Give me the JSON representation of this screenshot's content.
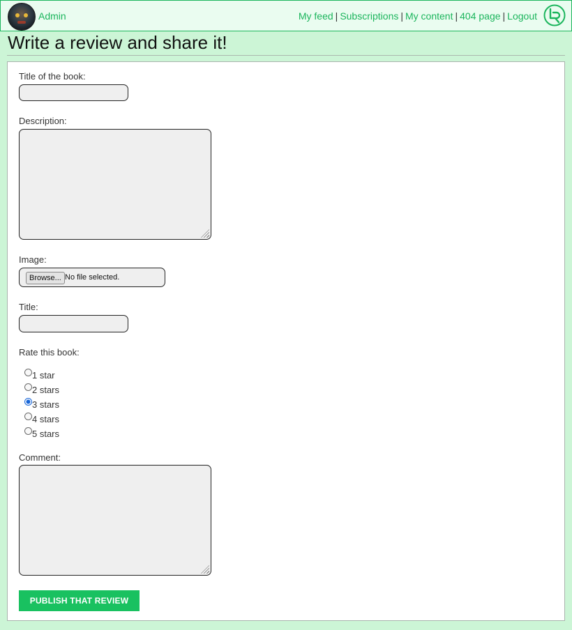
{
  "header": {
    "username": "Admin",
    "nav_links": [
      "My feed",
      "Subscriptions",
      "My content",
      "404 page",
      "Logout"
    ],
    "separator": "|"
  },
  "page": {
    "title": "Write a review and share it!"
  },
  "form": {
    "book_title_label": "Title of the book:",
    "book_title_value": "",
    "description_label": "Description:",
    "description_value": "",
    "image_label": "Image:",
    "browse_label": "Browse...",
    "file_status": "No file selected.",
    "title_label": "Title:",
    "title_value": "",
    "rating_label": "Rate this book:",
    "rating_options": [
      "1 star",
      "2 stars",
      "3 stars",
      "4 stars",
      "5 stars"
    ],
    "rating_selected": "3 stars",
    "comment_label": "Comment:",
    "comment_value": "",
    "submit_label": "PUBLISH THAT REVIEW"
  },
  "colors": {
    "accent": "#1bb55c",
    "button": "#19c160",
    "background": "#ccf5d6",
    "header_bg": "#eafcf0"
  },
  "icons": {
    "logo": "lr-logo-icon",
    "avatar": "user-avatar"
  }
}
